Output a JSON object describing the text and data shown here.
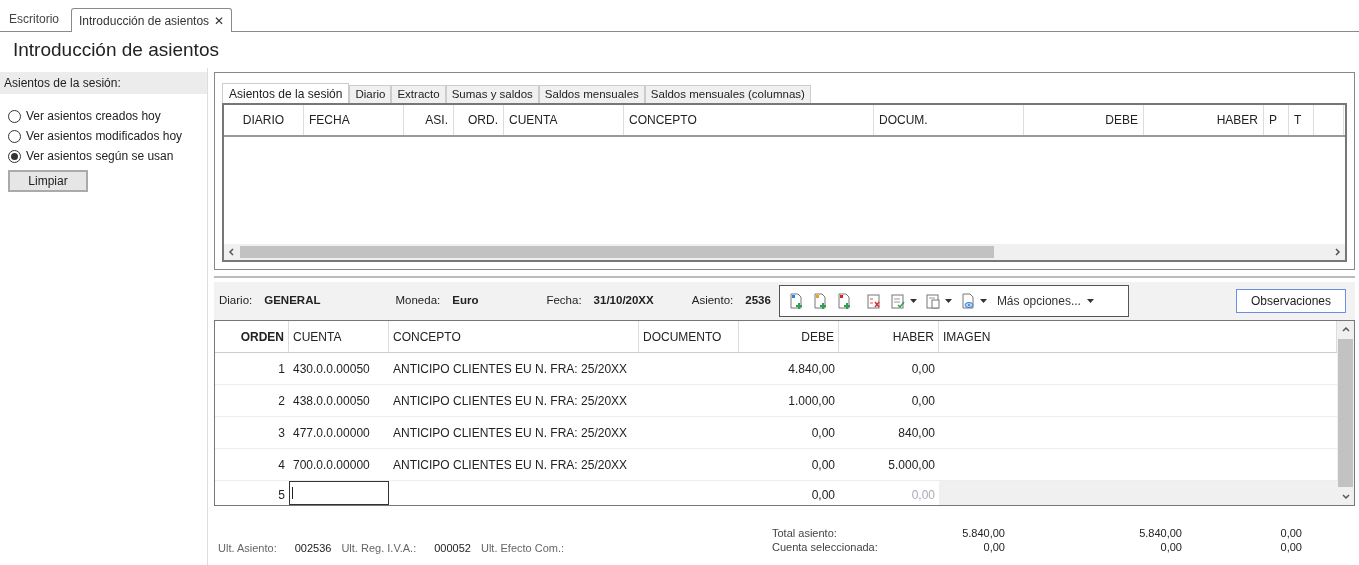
{
  "doc_tabs": [
    {
      "label": "Escritorio",
      "selected": false,
      "closable": false
    },
    {
      "label": "Introducción de asientos",
      "selected": true,
      "closable": true
    }
  ],
  "close_glyph": "✕",
  "title": "Introducción de asientos",
  "sidebar": {
    "heading": "Asientos de la sesión:",
    "options": [
      {
        "label": "Ver asientos creados hoy",
        "selected": false
      },
      {
        "label": "Ver asientos modificados hoy",
        "selected": false
      },
      {
        "label": "Ver asientos según se usan",
        "selected": true
      }
    ],
    "button": "Limpiar"
  },
  "session_tabs": [
    {
      "label": "Asientos de la sesión",
      "selected": true
    },
    {
      "label": "Diario",
      "selected": false
    },
    {
      "label": "Extracto",
      "selected": false
    },
    {
      "label": "Sumas y saldos",
      "selected": false
    },
    {
      "label": "Saldos mensuales",
      "selected": false
    },
    {
      "label": "Saldos mensuales (columnas)",
      "selected": false
    }
  ],
  "session_table": {
    "columns": [
      "DIARIO",
      "FECHA",
      "ASI.",
      "ORD.",
      "CUENTA",
      "CONCEPTO",
      "DOCUM.",
      "DEBE",
      "HABER",
      "P",
      "T"
    ]
  },
  "info": [
    {
      "label": "Diario:",
      "value": "GENERAL"
    },
    {
      "label": "Moneda:",
      "value": "Euro"
    },
    {
      "label": "Fecha:",
      "value": "31/10/20XX"
    },
    {
      "label": "Asiento:",
      "value": "2536"
    }
  ],
  "more_options": "Más opciones...",
  "observaciones": "Observaciones",
  "entry_table": {
    "columns": [
      "ORDEN",
      "CUENTA",
      "CONCEPTO",
      "DOCUMENTO",
      "DEBE",
      "HABER",
      "IMAGEN"
    ],
    "rows": [
      {
        "kind": "line",
        "orden": "1",
        "cuenta": "430.0.0.00050",
        "concepto": "ANTICIPO CLIENTES EU N. FRA:  25/20XX",
        "debe": "4.840,00",
        "haber": "0,00"
      },
      {
        "kind": "line",
        "orden": "2",
        "cuenta": "438.0.0.00050",
        "concepto": "ANTICIPO CLIENTES EU N. FRA:  25/20XX",
        "debe": "1.000,00",
        "haber": "0,00"
      },
      {
        "kind": "line",
        "orden": "3",
        "cuenta": "477.0.0.00000",
        "concepto": "ANTICIPO CLIENTES EU N. FRA:  25/20XX",
        "debe": "0,00",
        "haber": "840,00"
      },
      {
        "kind": "line",
        "orden": "4",
        "cuenta": "700.0.0.00000",
        "concepto": "ANTICIPO CLIENTES EU N. FRA:  25/20XX",
        "debe": "0,00",
        "haber": "5.000,00"
      },
      {
        "kind": "new",
        "orden": "5",
        "debe": "0,00",
        "haber": "0,00"
      }
    ]
  },
  "footer": {
    "left": [
      {
        "label": "Ult. Asiento:",
        "value": "002536"
      },
      {
        "label": "Ult. Reg. I.V.A.:",
        "value": "000052"
      },
      {
        "label": "Ult. Efecto Com.:"
      }
    ],
    "totals": [
      {
        "label": "Total asiento:",
        "values": [
          "5.840,00",
          "5.840,00",
          "0,00"
        ]
      },
      {
        "label": "Cuenta seleccionada:",
        "values": [
          "0,00",
          "0,00",
          "0,00"
        ]
      }
    ]
  }
}
